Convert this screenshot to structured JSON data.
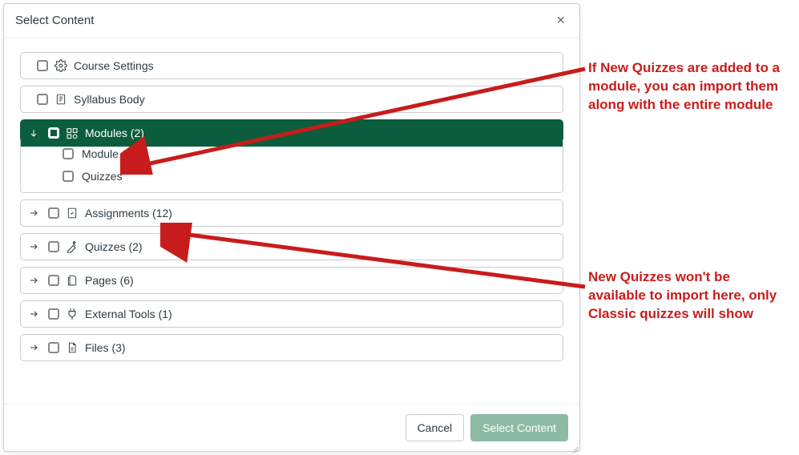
{
  "modal": {
    "title": "Select Content",
    "close_glyph": "×"
  },
  "tree": {
    "course_settings": "Course Settings",
    "syllabus_body": "Syllabus Body",
    "modules": {
      "label": "Modules (2)",
      "children": [
        "Module 1",
        "Quizzes"
      ]
    },
    "assignments": "Assignments (12)",
    "quizzes": "Quizzes (2)",
    "pages": "Pages (6)",
    "external_tools": "External Tools (1)",
    "files": "Files (3)"
  },
  "footer": {
    "cancel": "Cancel",
    "select": "Select Content"
  },
  "annotations": {
    "top": "If New Quizzes are added to a module, you can import them along with the entire module",
    "bottom": "New Quizzes won't be available to import here, only Classic quizzes will show"
  },
  "colors": {
    "annotation": "#c81c1c",
    "active_bg": "#0b5d3d"
  }
}
